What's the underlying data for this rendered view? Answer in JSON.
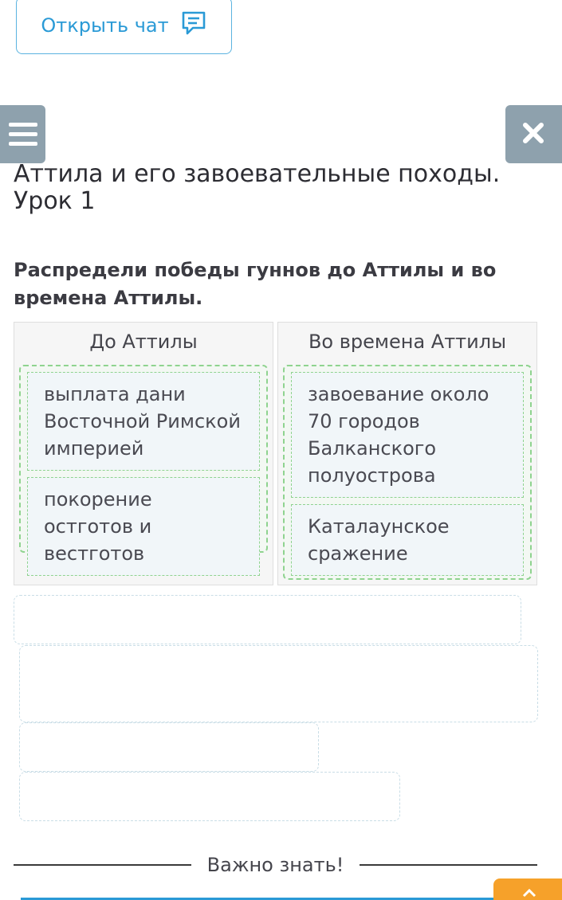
{
  "header": {
    "chat_button_label": "Открыть чат",
    "chat_icon": "chat-icon",
    "menu_icon": "hamburger-icon",
    "close_icon": "close-icon"
  },
  "lesson": {
    "title": "Аттила и его завоевательные походы. Урок 1",
    "task": "Распредели победы гуннов до Аттилы и во времена Аттилы."
  },
  "columns": [
    {
      "header": "До Аттилы",
      "items": [
        "выплата дани Восточной Римской империей",
        "покорение остготов и вестготов"
      ]
    },
    {
      "header": "Во времена Аттилы",
      "items": [
        "завоевание около 70 городов Балканского полуострова",
        "Каталаунское сражение"
      ]
    }
  ],
  "footer": {
    "important_label": "Важно знать!",
    "scroll_icon": "chevron-up-icon"
  },
  "colors": {
    "accent": "#2a9ad6",
    "header_buttons": "#8ea1ad",
    "correct_border": "#8fd38f",
    "scroll_button": "#f6a12a"
  }
}
